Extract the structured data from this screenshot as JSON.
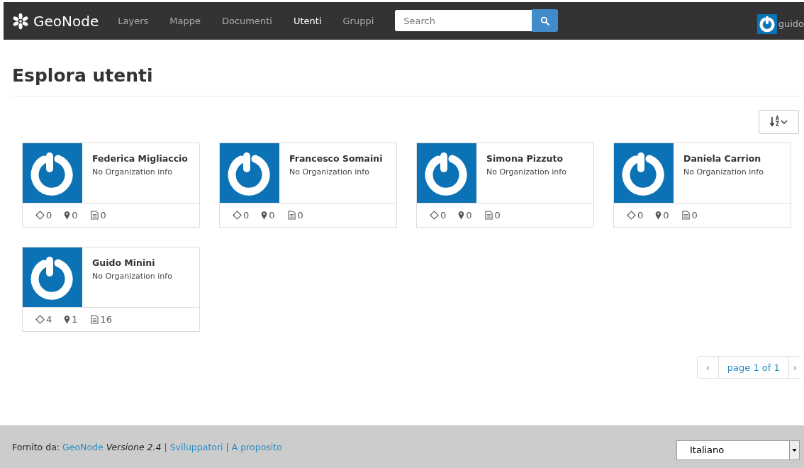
{
  "navbar": {
    "brand": "GeoNode",
    "items": [
      {
        "label": "Layers",
        "selected": false
      },
      {
        "label": "Mappe",
        "selected": false
      },
      {
        "label": "Documenti",
        "selected": false
      },
      {
        "label": "Utenti",
        "selected": true
      },
      {
        "label": "Gruppi",
        "selected": false
      }
    ],
    "search": {
      "placeholder": "Search"
    },
    "user": "guido"
  },
  "title": "Esplora utenti",
  "sort_button": {
    "top_letter": "A",
    "bottom_letter": "Z"
  },
  "users": [
    {
      "name": "Federica Migliaccio",
      "organization": "No Organization info",
      "layers": "0",
      "maps": "0",
      "documents": "0"
    },
    {
      "name": "Francesco Somaini",
      "organization": "No Organization info",
      "layers": "0",
      "maps": "0",
      "documents": "0"
    },
    {
      "name": "Simona Pizzuto",
      "organization": "No Organization info",
      "layers": "0",
      "maps": "0",
      "documents": "0"
    },
    {
      "name": "Daniela Carrion",
      "organization": "No Organization info",
      "layers": "0",
      "maps": "0",
      "documents": "0"
    },
    {
      "name": "Guido Minini",
      "organization": "No Organization info",
      "layers": "4",
      "maps": "1",
      "documents": "16"
    }
  ],
  "pagination": {
    "prev": "‹",
    "label": "page 1 of 1",
    "next": "›"
  },
  "footer": {
    "prefix": "Fornito da:",
    "brand_link": "GeoNode",
    "version": "Versione 2.4",
    "separator": "|",
    "links": [
      "Sviluppatori",
      "A proposito"
    ],
    "language": "Italiano"
  }
}
